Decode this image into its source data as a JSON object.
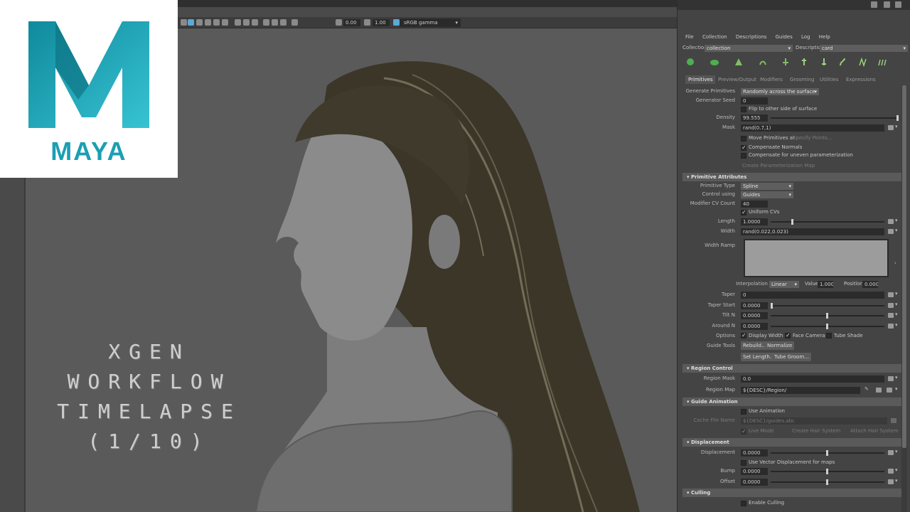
{
  "viewport": {
    "toolbar": {
      "field_a": "0.00",
      "field_b": "1.00",
      "color_space": "sRGB gamma"
    }
  },
  "logo": {
    "word": "MAYA"
  },
  "title": {
    "lines": [
      "XGEN",
      "WORKFLOW",
      "TIMELAPSE",
      "(1/10)"
    ]
  },
  "xgen": {
    "menu": [
      "File",
      "Collection",
      "Descriptions",
      "Guides",
      "Log",
      "Help"
    ],
    "collection_label": "Collection",
    "collection_value": "collection",
    "description_label": "Description",
    "description_value": "card",
    "tabs": [
      "Primitives",
      "Preview/Output",
      "Modifiers",
      "Grooming",
      "Utilities",
      "Expressions"
    ],
    "generator": {
      "generate_primitives_label": "Generate Primitives",
      "generate_primitives_value": "Randomly across the surface",
      "generator_seed_label": "Generator Seed",
      "generator_seed_value": "0",
      "flip_label": "Flip to other side of surface",
      "density_label": "Density",
      "density_value": "99.555",
      "mask_label": "Mask",
      "mask_value": "rand(0.7,1)",
      "move_primitives_label": "Move Primitives at",
      "specify_points_label": "Specify Points...",
      "compensate_normals_label": "Compensate Normals",
      "compensate_uneven_label": "Compensate for uneven parameterization",
      "create_param_map_label": "Create Parameterization Map"
    },
    "primitive_attributes": {
      "section_label": "Primitive Attributes",
      "primitive_type_label": "Primitive Type",
      "primitive_type_value": "Spline",
      "control_using_label": "Control using",
      "control_using_value": "Guides",
      "modifier_cv_count_label": "Modifier CV Count",
      "modifier_cv_count_value": "40",
      "uniform_cvs_label": "Uniform CVs",
      "length_label": "Length",
      "length_value": "1.0000",
      "width_label": "Width",
      "width_value": "rand(0.022,0.023)",
      "width_ramp_label": "Width Ramp",
      "interpolation_label": "Interpolation",
      "interpolation_value": "Linear",
      "value_label": "Value",
      "value_value": "1.000",
      "position_label": "Position",
      "position_value": "0.000",
      "taper_label": "Taper",
      "taper_value": "0",
      "taper_start_label": "Taper Start",
      "taper_start_value": "0.0000",
      "tilt_n_label": "Tilt N",
      "tilt_n_value": "0.0000",
      "around_n_label": "Around N",
      "around_n_value": "0.0000",
      "options_label": "Options",
      "display_width_label": "Display Width",
      "face_camera_label": "Face Camera",
      "tube_shade_label": "Tube Shade",
      "guide_tools_label": "Guide Tools",
      "rebuild_label": "Rebuild...",
      "normalize_label": "Normalize",
      "set_length_label": "Set Length...",
      "tube_groom_label": "Tube Groom..."
    },
    "region_control": {
      "section_label": "Region Control",
      "region_mask_label": "Region Mask",
      "region_mask_value": "0.0",
      "region_map_label": "Region Map",
      "region_map_value": "${DESC}/Region/"
    },
    "guide_animation": {
      "section_label": "Guide Animation",
      "use_animation_label": "Use Animation",
      "cache_file_name_label": "Cache File Name",
      "cache_file_name_value": "${DESC}/guides.abc",
      "live_mode_label": "Live Mode",
      "create_hair_system_label": "Create Hair System",
      "attach_hair_system_label": "Attach Hair System"
    },
    "displacement": {
      "section_label": "Displacement",
      "displacement_label": "Displacement",
      "displacement_value": "0.0000",
      "vector_displacement_label": "Use Vector Displacement for maps",
      "bump_label": "Bump",
      "bump_value": "0.0000",
      "offset_label": "Offset",
      "offset_value": "0.0000"
    },
    "culling": {
      "section_label": "Culling",
      "enable_culling_label": "Enable Culling"
    }
  },
  "colors": {
    "maya_teal": "#1b9fb3",
    "hair": "#3b3628",
    "skin": "#8a8a8a"
  }
}
